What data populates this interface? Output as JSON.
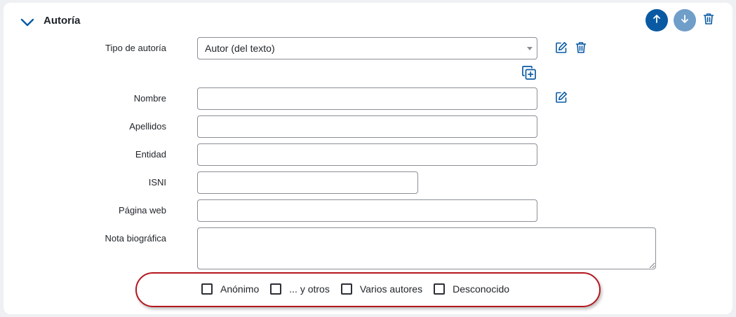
{
  "section": {
    "title": "Autoría"
  },
  "fields": {
    "tipo": {
      "label": "Tipo de autoría",
      "value": "Autor (del texto)"
    },
    "nombre": {
      "label": "Nombre",
      "value": ""
    },
    "apellidos": {
      "label": "Apellidos",
      "value": ""
    },
    "entidad": {
      "label": "Entidad",
      "value": ""
    },
    "isni": {
      "label": "ISNI",
      "value": ""
    },
    "pagina_web": {
      "label": "Página web",
      "value": ""
    },
    "nota": {
      "label": "Nota biográfica",
      "value": ""
    }
  },
  "checkboxes": [
    {
      "label": "Anónimo",
      "checked": false
    },
    {
      "label": "... y otros",
      "checked": false
    },
    {
      "label": "Varios autores",
      "checked": false
    },
    {
      "label": "Desconocido",
      "checked": false
    }
  ],
  "colors": {
    "accent": "#0a5aa3",
    "accent_light": "#6f9ec9",
    "highlight": "#b3181e"
  },
  "icons": {
    "collapse": "chevron-down-icon",
    "move_up": "arrow-up-icon",
    "move_down": "arrow-down-icon",
    "delete": "trash-icon",
    "edit": "edit-icon",
    "duplicate": "copy-plus-icon"
  }
}
